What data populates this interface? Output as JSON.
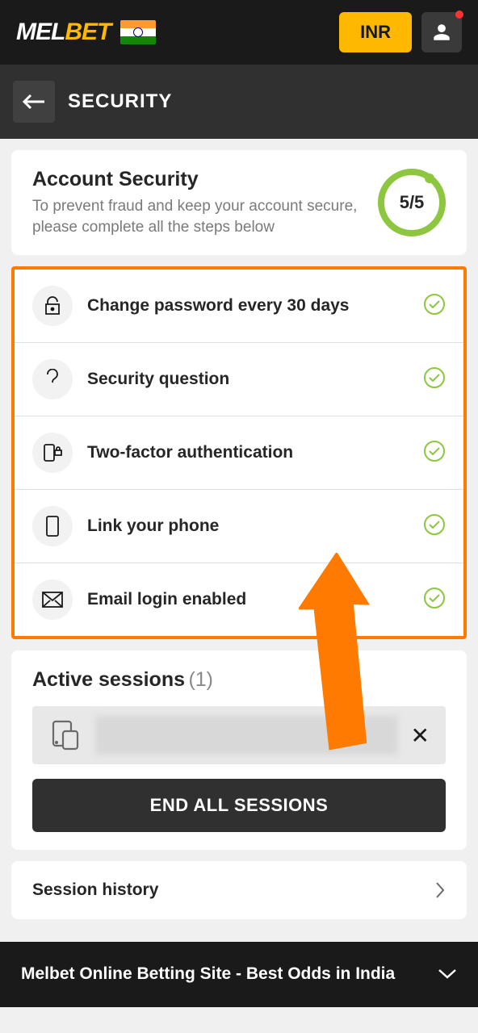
{
  "header": {
    "logo_mel": "MEL",
    "logo_bet": "BET",
    "currency_label": "INR"
  },
  "subheader": {
    "title": "SECURITY"
  },
  "account_security": {
    "title": "Account Security",
    "description": "To prevent fraud and keep your account secure, please complete all the steps below",
    "progress": "5/5"
  },
  "security_items": {
    "0": {
      "label": "Change password every 30 days"
    },
    "1": {
      "label": "Security question"
    },
    "2": {
      "label": "Two-factor authentication"
    },
    "3": {
      "label": "Link your phone"
    },
    "4": {
      "label": "Email login enabled"
    }
  },
  "sessions": {
    "title": "Active sessions",
    "count": "(1)",
    "end_all_label": "END ALL SESSIONS"
  },
  "session_history": {
    "label": "Session history"
  },
  "footer": {
    "text": "Melbet Online Betting Site - Best Odds in India"
  }
}
